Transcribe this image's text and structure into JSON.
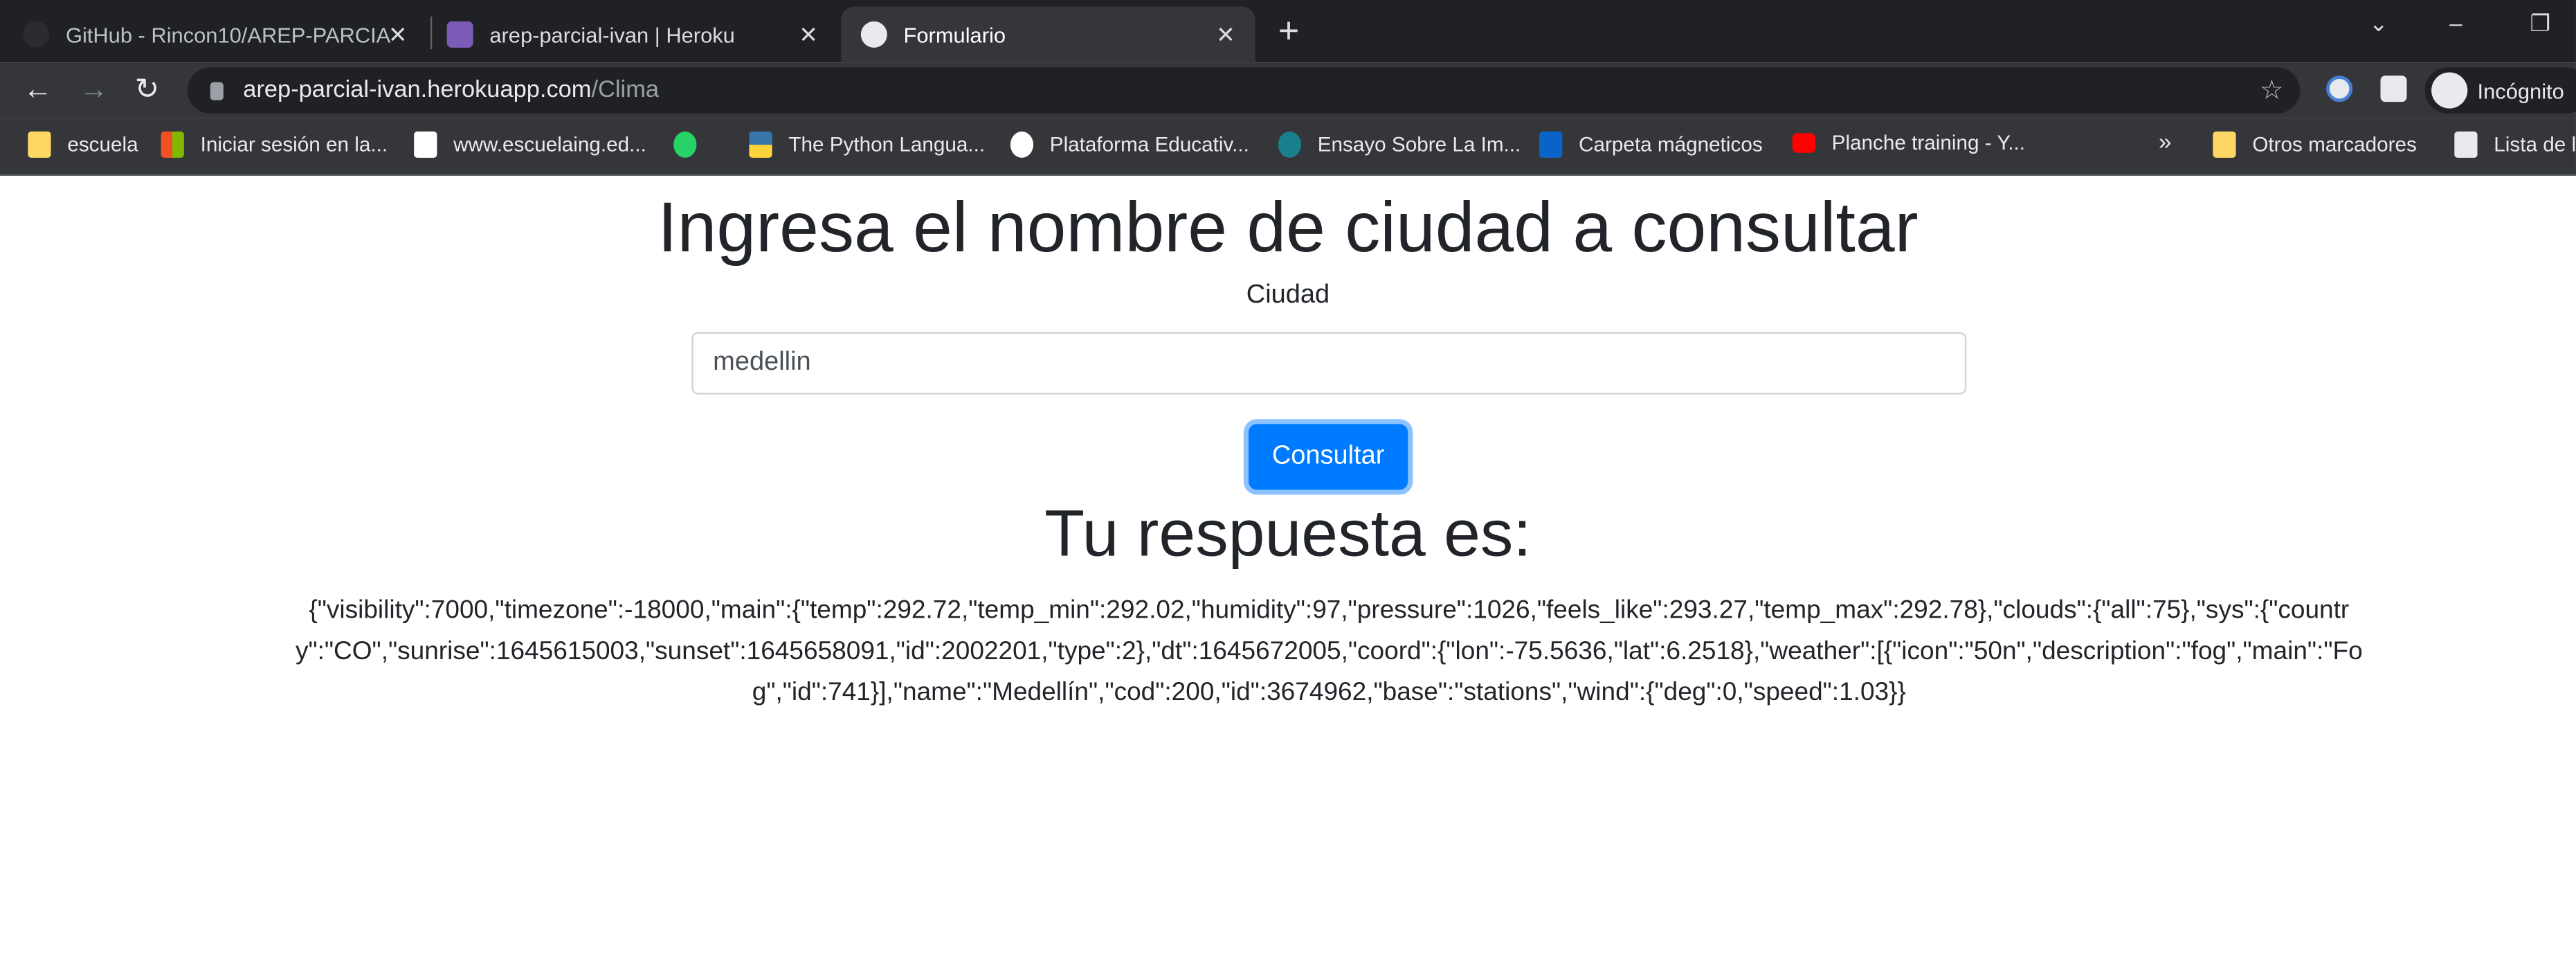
{
  "browser": {
    "tabs": [
      {
        "title": "GitHub - Rincon10/AREP-PARCIA",
        "active": false
      },
      {
        "title": "arep-parcial-ivan | Heroku",
        "active": false
      },
      {
        "title": "Formulario",
        "active": true
      }
    ],
    "close_glyph": "✕",
    "new_tab_glyph": "+",
    "url_host": "arep-parcial-ivan.herokuapp.com",
    "url_path": "/Clima",
    "profile_label": "Incógnito",
    "bookmarks": [
      {
        "label": "escuela",
        "icon": "folder-icon",
        "color": "#fdd663"
      },
      {
        "label": "Iniciar sesión en la...",
        "icon": "microsoft-icon",
        "color": "#f25022"
      },
      {
        "label": "www.escuelaing.ed...",
        "icon": "page-icon",
        "color": "#ffffff"
      },
      {
        "label": "",
        "icon": "whatsapp-icon",
        "color": "#25d366"
      },
      {
        "label": "The Python Langua...",
        "icon": "python-icon",
        "color": "#3776ab"
      },
      {
        "label": "Plataforma Educativ...",
        "icon": "globe-icon",
        "color": "#ffffff"
      },
      {
        "label": "Ensayo Sobre La Im...",
        "icon": "s-icon",
        "color": "#1a7f8c"
      },
      {
        "label": "Carpeta mágneticos",
        "icon": "outlook-icon",
        "color": "#0a64c8"
      },
      {
        "label": "Planche training - Y...",
        "icon": "youtube-icon",
        "color": "#ff0000"
      }
    ],
    "more_bookmarks": "»",
    "other_bookmarks": "Otros marcadores",
    "reading_list": "Lista de l"
  },
  "page": {
    "title": "Ingresa el nombre de ciudad a consultar",
    "city_label": "Ciudad",
    "city_value": "medellin",
    "submit_label": "Consultar",
    "response_heading": "Tu respuesta es:",
    "response_text": "{\"visibility\":7000,\"timezone\":-18000,\"main\":{\"temp\":292.72,\"temp_min\":292.02,\"humidity\":97,\"pressure\":1026,\"feels_like\":293.27,\"temp_max\":292.78},\"clouds\":{\"all\":75},\"sys\":{\"country\":\"CO\",\"sunrise\":1645615003,\"sunset\":1645658091,\"id\":2002201,\"type\":2},\"dt\":1645672005,\"coord\":{\"lon\":-75.5636,\"lat\":6.2518},\"weather\":[{\"icon\":\"50n\",\"description\":\"fog\",\"main\":\"Fog\",\"id\":741}],\"name\":\"Medellín\",\"cod\":200,\"id\":3674962,\"base\":\"stations\",\"wind\":{\"deg\":0,\"speed\":1.03}}",
    "accent_color": "#007bff"
  }
}
